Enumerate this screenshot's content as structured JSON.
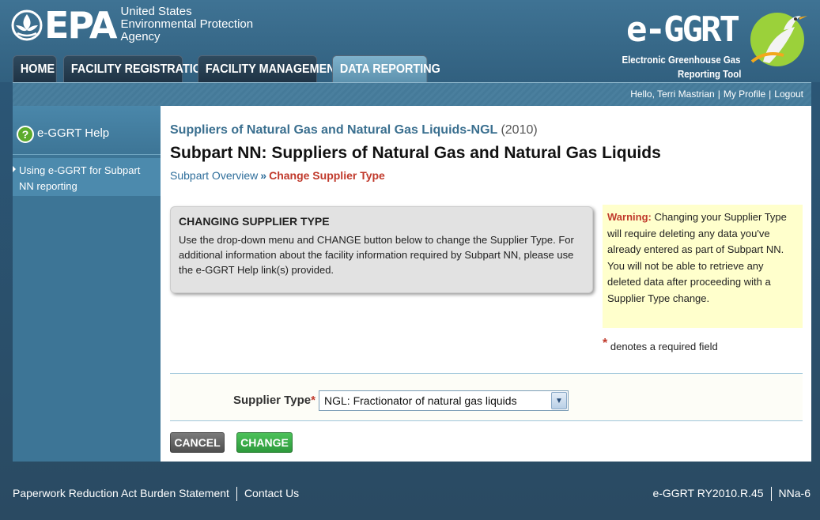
{
  "header": {
    "agency_lines": [
      "United States",
      "Environmental Protection",
      "Agency"
    ],
    "epa_word": "EPA",
    "tool_name": "e-GGRT",
    "tool_desc_line1": "Electronic Greenhouse Gas",
    "tool_desc_line2": "Reporting Tool"
  },
  "nav": {
    "tabs": [
      {
        "label": "HOME",
        "active": false
      },
      {
        "label": "FACILITY REGISTRATION",
        "active": false
      },
      {
        "label": "FACILITY MANAGEMENT",
        "active": false
      },
      {
        "label": "DATA REPORTING",
        "active": true
      }
    ]
  },
  "userbar": {
    "greeting": "Hello, Terri Mastrian",
    "profile": "My Profile",
    "logout": "Logout"
  },
  "sidebar": {
    "help_label": "e-GGRT Help",
    "link_label": "Using e-GGRT for Subpart NN reporting"
  },
  "main": {
    "supplier_heading": "Suppliers of Natural Gas and Natural Gas Liquids-NGL",
    "year": "(2010)",
    "title": "Subpart NN: Suppliers of Natural Gas and Natural Gas Liquids",
    "breadcrumb": {
      "link": "Subpart Overview",
      "sep": "»",
      "current": "Change Supplier Type"
    },
    "info_box": {
      "title": "CHANGING SUPPLIER TYPE",
      "text": "Use the drop-down menu and CHANGE button below to change the Supplier Type. For additional information about the facility information required by Subpart NN, please use the e-GGRT Help link(s) provided."
    },
    "warning": {
      "label": "Warning:",
      "text": "Changing your Supplier Type will require deleting any data you've already entered as part of Subpart NN. You will not be able to retrieve any deleted data after proceeding with a Supplier Type change."
    },
    "required_note": "denotes a required field",
    "form": {
      "supplier_type_label": "Supplier Type",
      "supplier_type_value": "NGL: Fractionator of natural gas liquids"
    },
    "buttons": {
      "cancel": "CANCEL",
      "change": "CHANGE"
    }
  },
  "footer": {
    "paperwork": "Paperwork Reduction Act Burden Statement",
    "contact": "Contact Us",
    "version": "e-GGRT RY2010.R.45",
    "page_id": "NNa-6"
  },
  "colors": {
    "header_bg": "#3f7394",
    "sidebar_bg": "#3d7596",
    "breadcrumb_current": "#c0392b",
    "change_button": "#2e9a3c",
    "cancel_button": "#4f4f4f",
    "warning_bg": "#ffffcc"
  }
}
